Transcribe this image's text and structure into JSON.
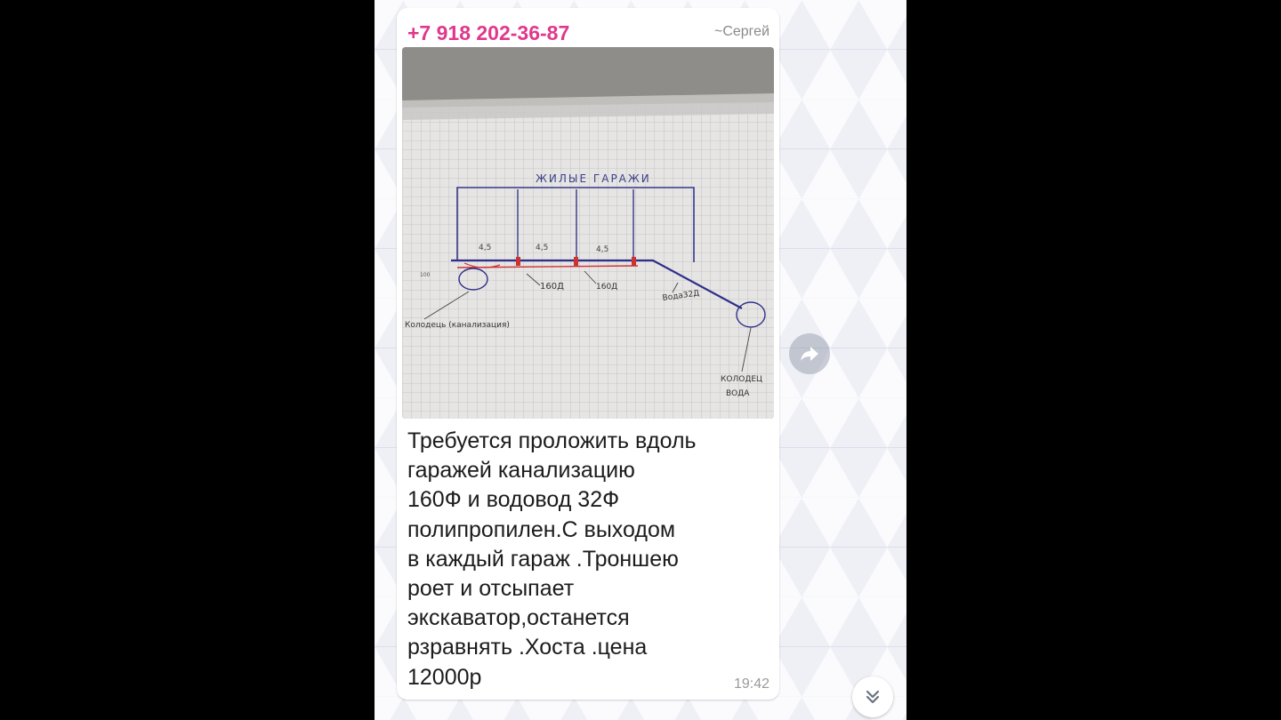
{
  "message": {
    "sender_phone": "+7 918 202-36-87",
    "sender_alias": "~Сергей",
    "text": "Требуется проложить вдоль\nгаражей канализацию\n160Ф  и водовод 32Ф\nполипропилен.С выходом\nв каждый гараж .Троншею\nроет и отсыпает\nэкскаватор,останется\nрзравнять .Хоста .цена\n12000р",
    "time": "19:42"
  },
  "photo": {
    "title": "ЖИЛЫЕ ГАРАЖИ",
    "labels": [
      "4,5",
      "4,5",
      "4,5"
    ],
    "pipe_160_labels": [
      "160Д",
      "160Д"
    ],
    "water_label": "Вода32Д",
    "septic_label": "Колодець (канализация)",
    "well_label_1": "КОЛОДЕЦ",
    "well_label_2": "ВОДА",
    "small_mark": "100"
  },
  "icons": {
    "share": "share-arrow-icon",
    "scroll": "chevron-double-down-icon"
  },
  "colors": {
    "sender": "#e0388c",
    "text": "#1c1c1c",
    "time": "#9a9a9a"
  }
}
